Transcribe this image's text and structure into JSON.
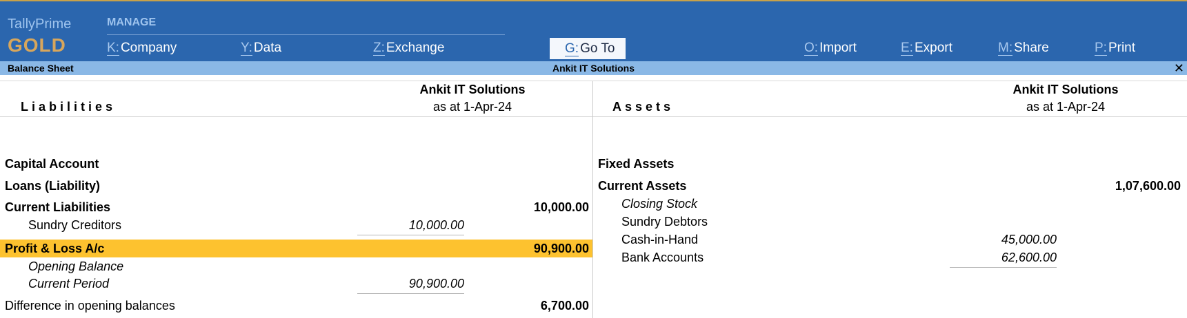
{
  "app": {
    "name": "TallyPrime",
    "edition": "GOLD"
  },
  "menu": {
    "section_label": "MANAGE",
    "items": [
      {
        "key": "K:",
        "label": "Company"
      },
      {
        "key": "Y:",
        "label": "Data"
      },
      {
        "key": "Z:",
        "label": "Exchange"
      },
      {
        "key": "G:",
        "label": "Go To"
      },
      {
        "key": "O:",
        "label": "Import"
      },
      {
        "key": "E:",
        "label": "Export"
      },
      {
        "key": "M:",
        "label": "Share"
      },
      {
        "key": "P:",
        "label": "Print"
      }
    ]
  },
  "titlebar": {
    "report": "Balance Sheet",
    "company": "Ankit IT Solutions",
    "close": "✕"
  },
  "liabilities": {
    "heading": "Liabilities",
    "company": "Ankit IT Solutions",
    "date": "as at 1-Apr-24",
    "rows": [
      {
        "label": "Capital Account",
        "sub": "",
        "main": ""
      },
      {
        "label": "Loans (Liability)",
        "sub": "",
        "main": ""
      },
      {
        "label": "Current Liabilities",
        "sub": "",
        "main": "10,000.00"
      },
      {
        "label": "Sundry Creditors",
        "sub": "10,000.00",
        "main": ""
      },
      {
        "label": "Profit & Loss A/c",
        "sub": "",
        "main": "90,900.00"
      },
      {
        "label": "Opening Balance",
        "sub": "",
        "main": ""
      },
      {
        "label": "Current Period",
        "sub": "90,900.00",
        "main": ""
      },
      {
        "label": "Difference in opening balances",
        "sub": "",
        "main": "6,700.00"
      }
    ]
  },
  "assets": {
    "heading": "Assets",
    "company": "Ankit IT Solutions",
    "date": "as at 1-Apr-24",
    "rows": [
      {
        "label": "Fixed Assets",
        "sub": "",
        "main": ""
      },
      {
        "label": "Current Assets",
        "sub": "",
        "main": "1,07,600.00"
      },
      {
        "label": "Closing Stock",
        "sub": "",
        "main": ""
      },
      {
        "label": "Sundry Debtors",
        "sub": "",
        "main": ""
      },
      {
        "label": "Cash-in-Hand",
        "sub": "45,000.00",
        "main": ""
      },
      {
        "label": "Bank Accounts",
        "sub": "62,600.00",
        "main": ""
      }
    ]
  },
  "colors": {
    "topbar": "#2b66ae",
    "titlebar": "#8ab8e6",
    "highlight": "#fdc22f",
    "brand_edition": "#d7a65c"
  }
}
